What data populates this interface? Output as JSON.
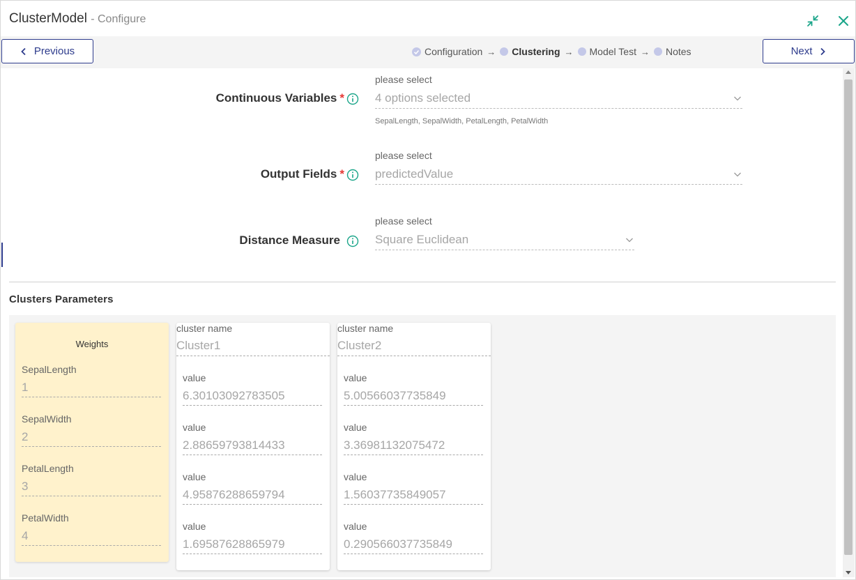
{
  "window": {
    "title": "ClusterModel",
    "subtitle": "- Configure"
  },
  "colors": {
    "accent": "#2d3b8c",
    "teal": "#1aa589",
    "required": "#e53935",
    "weights_bg": "#fff2cc"
  },
  "icons": {
    "minimize": "compress-arrows-icon",
    "close": "close-icon",
    "info": "info-circle-icon",
    "chevron": "chevron-down-icon"
  },
  "nav": {
    "previous_label": "Previous",
    "next_label": "Next"
  },
  "steps": [
    {
      "label": "Configuration",
      "state": "done"
    },
    {
      "label": "Clustering",
      "state": "active"
    },
    {
      "label": "Model Test",
      "state": "pending"
    },
    {
      "label": "Notes",
      "state": "pending"
    }
  ],
  "form": {
    "continuous": {
      "label": "Continuous Variables",
      "required": "*",
      "hint": "please select",
      "value": "4 options selected",
      "note": "SepalLength, SepalWidth, PetalLength, PetalWidth"
    },
    "output": {
      "label": "Output Fields",
      "required": "*",
      "hint": "please select",
      "value": "predictedValue"
    },
    "distance": {
      "label": "Distance Measure",
      "hint": "please select",
      "value": "Square Euclidean"
    }
  },
  "clusters": {
    "section_title": "Clusters Parameters",
    "weights": {
      "title": "Weights",
      "fields": [
        {
          "label": "SepalLength",
          "value": "1"
        },
        {
          "label": "SepalWidth",
          "value": "2"
        },
        {
          "label": "PetalLength",
          "value": "3"
        },
        {
          "label": "PetalWidth",
          "value": "4"
        }
      ]
    },
    "cards": [
      {
        "name_label": "cluster name",
        "name": "Cluster1",
        "values": [
          {
            "label": "value",
            "value": "6.30103092783505"
          },
          {
            "label": "value",
            "value": "2.88659793814433"
          },
          {
            "label": "value",
            "value": "4.95876288659794"
          },
          {
            "label": "value",
            "value": "1.69587628865979"
          }
        ]
      },
      {
        "name_label": "cluster name",
        "name": "Cluster2",
        "values": [
          {
            "label": "value",
            "value": "5.00566037735849"
          },
          {
            "label": "value",
            "value": "3.36981132075472"
          },
          {
            "label": "value",
            "value": "1.56037735849057"
          },
          {
            "label": "value",
            "value": "0.290566037735849"
          }
        ]
      }
    ]
  }
}
